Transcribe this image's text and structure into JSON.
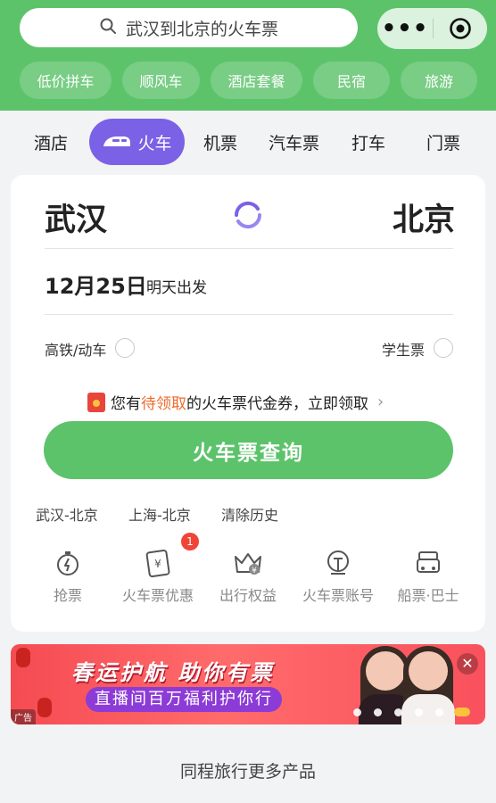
{
  "header": {
    "search_text": "武汉到北京的火车票",
    "menu_label": "•••",
    "quick_links": [
      "低价拼车",
      "顺风车",
      "酒店套餐",
      "民宿",
      "旅游"
    ]
  },
  "tabs": {
    "hotel": "酒店",
    "train": "火车",
    "flight": "机票",
    "bus": "汽车票",
    "taxi": "打车",
    "ticket": "门票"
  },
  "booking": {
    "from_city": "武汉",
    "to_city": "北京",
    "date": "12月25日",
    "date_note": "明天出发",
    "option_highspeed": "高铁/动车",
    "option_student": "学生票",
    "coupon_prefix": "您有",
    "coupon_highlight": "待领取",
    "coupon_suffix": "的火车票代金券，立即领取",
    "query_button": "火车票查询",
    "history": [
      "武汉-北京",
      "上海-北京",
      "清除历史"
    ]
  },
  "services": {
    "items": [
      "抢票",
      "火车票优惠",
      "出行权益",
      "火车票账号",
      "船票·巴士"
    ],
    "badge_count": "1"
  },
  "banner": {
    "title": "春运护航 助你有票",
    "subtitle": "直播间百万福利护你行",
    "ad_label": "广告",
    "close": "✕"
  },
  "footer": {
    "more_products": "同程旅行更多产品"
  },
  "colors": {
    "brand_green": "#5cc36b",
    "accent_purple": "#7b61e6",
    "highlight_orange": "#ef6a2d",
    "badge_red": "#ef4537"
  }
}
